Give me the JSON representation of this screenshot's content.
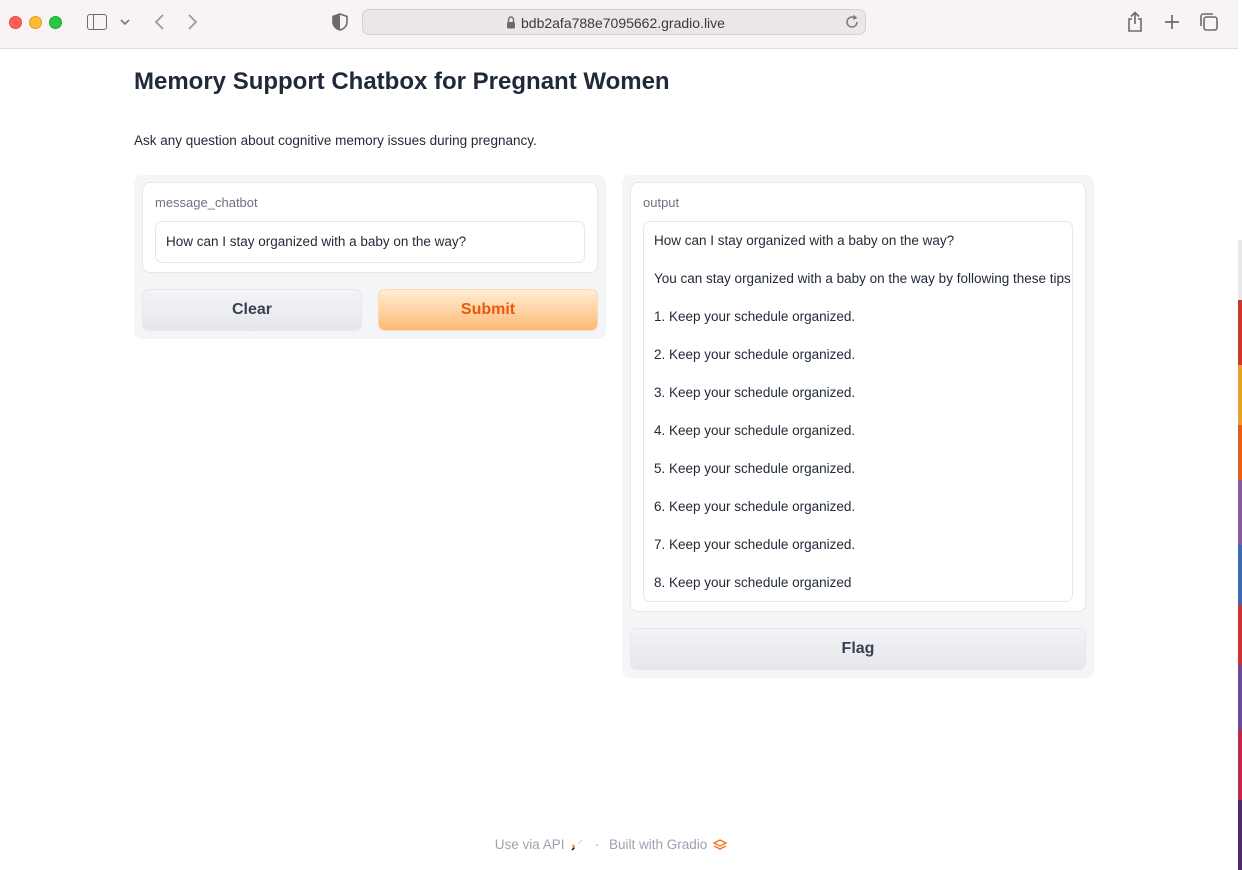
{
  "browser": {
    "url": "bdb2afa788e7095662.gradio.live"
  },
  "page": {
    "title": "Memory Support Chatbox for Pregnant Women",
    "description": "Ask any question about cognitive memory issues during pregnancy."
  },
  "input_panel": {
    "label": "message_chatbot",
    "value": "How can I stay organized with a baby on the way?",
    "clear_label": "Clear",
    "submit_label": "Submit"
  },
  "output_panel": {
    "label": "output",
    "lines": [
      "How can I stay organized with a baby on the way?",
      "You can stay organized with a baby on the way by following these tips:",
      "1. Keep your schedule organized.",
      "2. Keep your schedule organized.",
      "3. Keep your schedule organized.",
      "4. Keep your schedule organized.",
      "5. Keep your schedule organized.",
      "6. Keep your schedule organized.",
      "7. Keep your schedule organized.",
      "8. Keep your schedule organized"
    ],
    "flag_label": "Flag"
  },
  "footer": {
    "api_label": "Use via API",
    "separator": "·",
    "built_label": "Built with Gradio"
  },
  "colors": {
    "accent": "#ea580c",
    "submit_gradient_top": "#ffedd5",
    "submit_gradient_bottom": "#fdba74",
    "panel_bg": "#f4f5f7"
  },
  "icons": [
    "sidebar-icon",
    "chevron-down-icon",
    "back-icon",
    "forward-icon",
    "shield-icon",
    "lock-icon",
    "reload-icon",
    "share-icon",
    "new-tab-icon",
    "tab-overview-icon",
    "rocket-icon",
    "gradio-logo-icon"
  ]
}
